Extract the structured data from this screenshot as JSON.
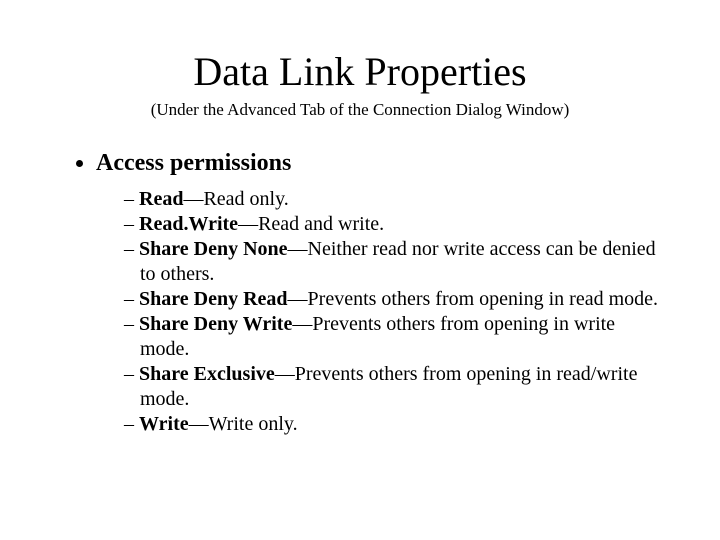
{
  "title": "Data Link Properties",
  "subtitle": "(Under the Advanced Tab of the Connection Dialog Window)",
  "section": "Access permissions",
  "items": [
    {
      "term": "Read",
      "desc": "—Read only."
    },
    {
      "term": "Read.Write",
      "desc": "—Read and write."
    },
    {
      "term": "Share Deny None",
      "desc": "—Neither read nor write access can be denied to others."
    },
    {
      "term": "Share Deny Read",
      "desc": "—Prevents others from opening in read mode."
    },
    {
      "term": "Share Deny Write",
      "desc": "—Prevents others from opening in write mode."
    },
    {
      "term": "Share Exclusive",
      "desc": "—Prevents others from opening in read/write mode."
    },
    {
      "term": "Write",
      "desc": "—Write only."
    }
  ]
}
